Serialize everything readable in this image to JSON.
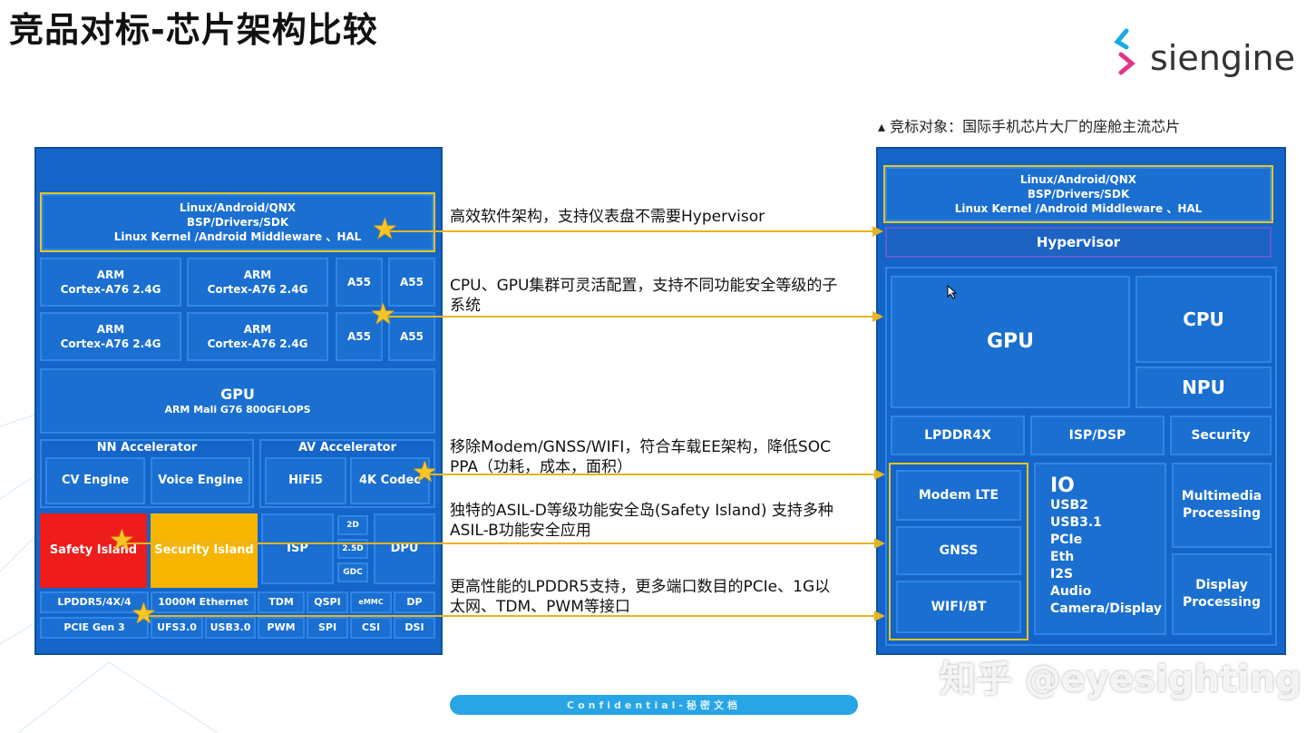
{
  "title": "竞品对标-芯片架构比较",
  "logo": {
    "text": "siengine"
  },
  "subtitle": "竞标对象：国际手机芯片大厂的座舱主流芯片",
  "left_chip": {
    "os": {
      "line1": "Linux/Android/QNX",
      "line2": "BSP/Drivers/SDK",
      "line3": "Linux Kernel /Android Middleware 、HAL"
    },
    "cpu": [
      {
        "line1": "ARM",
        "line2": "Cortex-A76 2.4G"
      },
      {
        "line1": "ARM",
        "line2": "Cortex-A76 2.4G"
      },
      {
        "line1": "ARM",
        "line2": "Cortex-A76 2.4G"
      },
      {
        "line1": "ARM",
        "line2": "Cortex-A76 2.4G"
      }
    ],
    "a55": [
      "A55",
      "A55",
      "A55",
      "A55"
    ],
    "gpu": {
      "line1": "GPU",
      "line2": "ARM Mali G76 800GFLOPS"
    },
    "nn": {
      "title": "NN Accelerator",
      "items": [
        "CV  Engine",
        "Voice Engine"
      ]
    },
    "av": {
      "title": "AV Accelerator",
      "items": [
        "HiFi5",
        "4K Codec"
      ]
    },
    "safety": "Safety Island",
    "security": "Security Island",
    "isp": "ISP",
    "small": [
      "2D",
      "2.5D",
      "GDC"
    ],
    "dpu": "DPU",
    "io_row1": [
      "LPDDR5/4X/4",
      "1000M Ethernet",
      "TDM",
      "QSPI",
      "eMMC",
      "DP"
    ],
    "io_row2": [
      "PCIE Gen 3",
      "UFS3.0",
      "USB3.0",
      "PWM",
      "SPI",
      "CSI",
      "DSI"
    ]
  },
  "notes": [
    {
      "line1": "高效软件架构，支持仪表盘不需要Hypervisor",
      "line2": ""
    },
    {
      "line1": "CPU、GPU集群可灵活配置，支持不同功能安全等级的子",
      "line2": "系统"
    },
    {
      "line1": "移除Modem/GNSS/WIFI，符合车载EE架构，降低SOC",
      "line2": "PPA（功耗，成本，面积）"
    },
    {
      "line1": "独特的ASIL-D等级功能安全岛(Safety Island) 支持多种",
      "line2": "ASIL-B功能安全应用"
    },
    {
      "line1": "更高性能的LPDDR5支持，更多端口数目的PCIe、1G以",
      "line2": "太网、TDM、PWM等接口"
    }
  ],
  "right_chip": {
    "os": {
      "line1": "Linux/Android/QNX",
      "line2": "BSP/Drivers/SDK",
      "line3": "Linux Kernel /Android Middleware 、HAL"
    },
    "hypervisor": "Hypervisor",
    "gpu": "GPU",
    "cpu": "CPU",
    "npu": "NPU",
    "lpddr": "LPDDR4X",
    "isp": "ISP/DSP",
    "security": "Security",
    "modem": "Modem LTE",
    "gnss": "GNSS",
    "wifi": "WIFI/BT",
    "io": {
      "title": "IO",
      "items": [
        "USB2",
        "USB3.1",
        "PCIe",
        "Eth",
        "I2S",
        "Audio",
        "Camera/Display"
      ]
    },
    "multimedia": "Multimedia Processing",
    "display": "Display Processing"
  },
  "confidential": "Confidential-秘密文档",
  "watermark": "知乎 @eyesighting",
  "colors": {
    "chip_bg": "#1565c8",
    "block_border": "#2f86e6",
    "highlight": "#e6c61e",
    "safety": "#ee1c1c",
    "security": "#f7b500",
    "arrow": "#e6b422"
  }
}
